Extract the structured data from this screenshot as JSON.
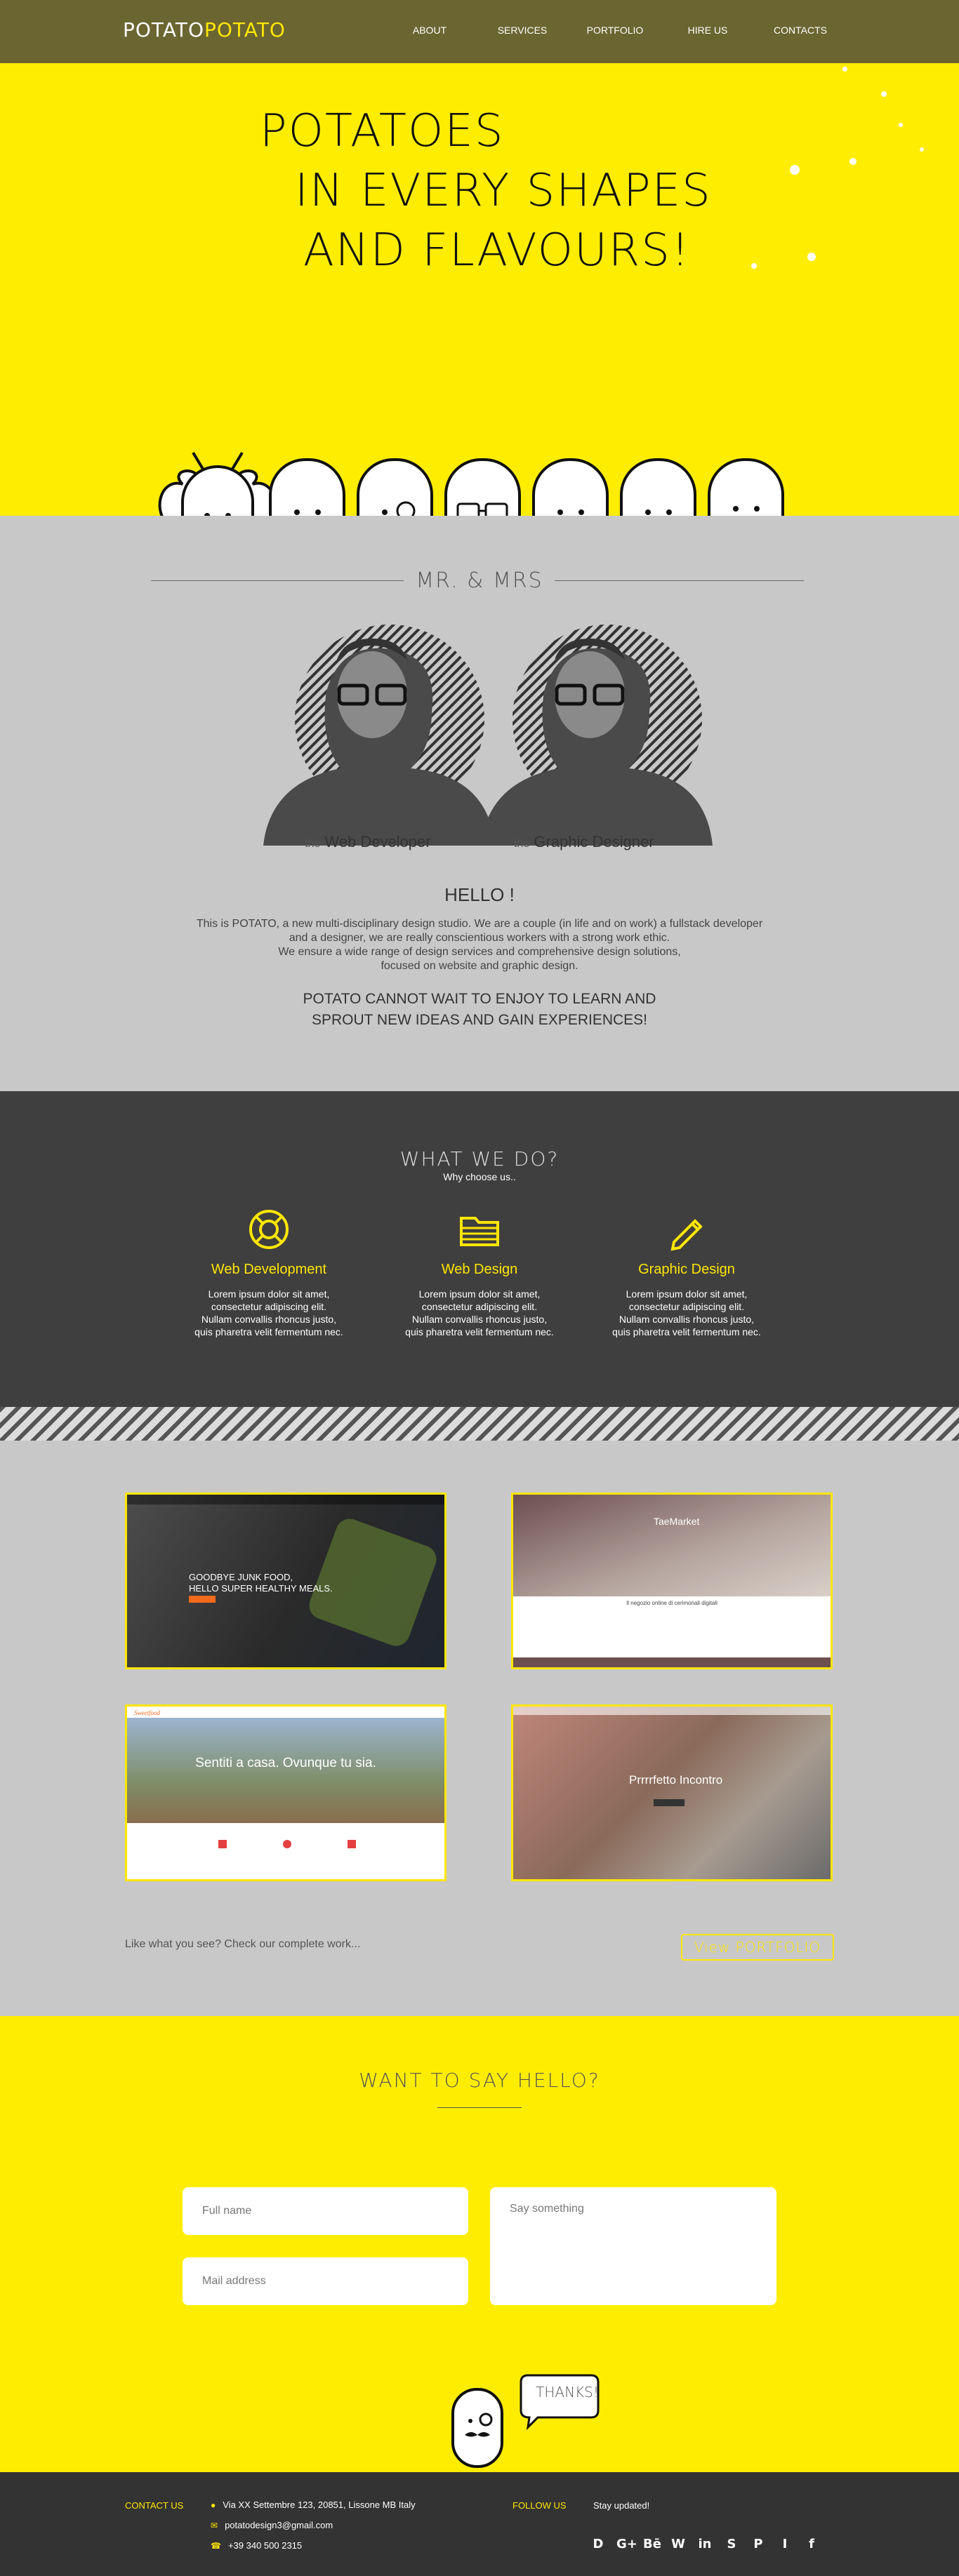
{
  "header": {
    "logo_a": "POTATO",
    "logo_b": "POTATO",
    "nav": [
      "ABOUT",
      "SERVICES",
      "PORTFOLIO",
      "HIRE US",
      "CONTACTS"
    ]
  },
  "hero": {
    "line1": "POTATOES",
    "line2": "IN EVERY SHAPES",
    "line3": "AND FLAVOURS!"
  },
  "about": {
    "title": "MR. & MRS",
    "role1_prefix": "the",
    "role1": "Web Developer",
    "role2_prefix": "the",
    "role2": "Graphic Designer",
    "hello": "HELLO !",
    "p1": "This is POTATO, a new multi-disciplinary design studio. We are a couple (in life and on work) a fullstack developer",
    "p2": "and a designer, we are really conscientious workers with a strong work ethic.",
    "p3": "We ensure a wide range of design services and comprehensive design solutions,",
    "p4": "focused on website and graphic design.",
    "claim1": "POTATO CANNOT WAIT TO ENJOY TO LEARN AND",
    "claim2": "SPROUT NEW IDEAS AND GAIN EXPERIENCES!"
  },
  "services": {
    "title": "WHAT WE DO?",
    "subtitle": "Why choose us..",
    "items": [
      {
        "icon": "lifebuoy-icon",
        "title": "Web Development",
        "l1": "Lorem ipsum dolor sit amet,",
        "l2": "consectetur adipiscing elit.",
        "l3": "Nullam convallis rhoncus justo,",
        "l4": "quis pharetra velit fermentum nec."
      },
      {
        "icon": "folder-icon",
        "title": "Web Design",
        "l1": "Lorem ipsum dolor sit amet,",
        "l2": "consectetur adipiscing elit.",
        "l3": "Nullam convallis rhoncus justo,",
        "l4": "quis pharetra velit fermentum nec."
      },
      {
        "icon": "pencil-icon",
        "title": "Graphic Design",
        "l1": "Lorem ipsum dolor sit amet,",
        "l2": "consectetur adipiscing elit.",
        "l3": "Nullam convallis rhoncus justo,",
        "l4": "quis pharetra velit fermentum nec."
      }
    ]
  },
  "portfolio": {
    "cards": [
      {
        "headline1": "GOODBYE JUNK FOOD,",
        "headline2": "HELLO SUPER HEALTHY MEALS."
      },
      {
        "brand": "TaeMarket",
        "caption": "Il negozio online di cerimonali digitali"
      },
      {
        "brand": "Sweetfood",
        "headline": "Sentiti a casa. Ovunque tu sia."
      },
      {
        "headline": "Prrrrfetto Incontro"
      }
    ],
    "cta_text": "Like what you see? Check our complete work...",
    "cta_button": "View PORTFOLIO"
  },
  "contact": {
    "title": "WANT TO SAY HELLO?",
    "name_placeholder": "Full name",
    "mail_placeholder": "Mail address",
    "message_placeholder": "Say something",
    "thanks": "THANKS!"
  },
  "footer": {
    "contact_label": "CONTACT US",
    "address": "Via XX Settembre 123, 20851, Lissone MB Italy",
    "email": "potatodesign3@gmail.com",
    "phone": "+39 340 500 2315",
    "follow_label": "FOLLOW US",
    "stay": "Stay updated!",
    "social": [
      "D",
      "G+",
      "Bē",
      "W",
      "in",
      "S",
      "P",
      "I",
      "f"
    ]
  },
  "colors": {
    "yellow": "#ffed00",
    "olive": "#6b6531",
    "grey": "#c8c8c8",
    "dark": "#3f3f3f"
  }
}
